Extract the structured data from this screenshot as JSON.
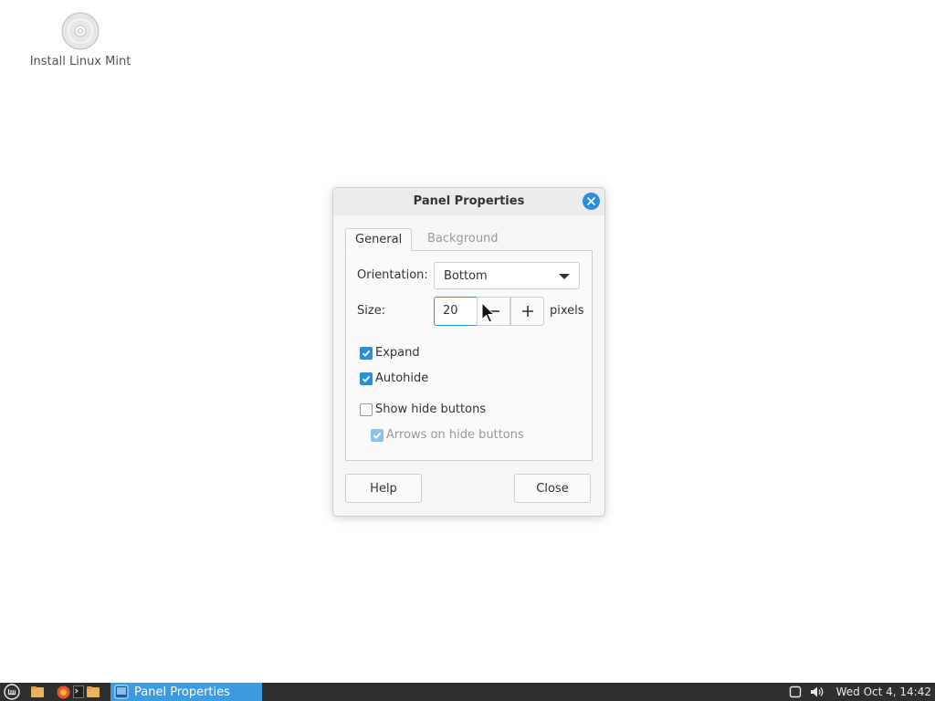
{
  "desktop": {
    "icons": [
      {
        "label": "Install Linux Mint",
        "icon": "disc-icon"
      }
    ]
  },
  "dialog": {
    "title": "Panel Properties",
    "tabs": [
      {
        "label": "General",
        "active": true
      },
      {
        "label": "Background",
        "active": false
      }
    ],
    "orientation": {
      "label": "Orientation:",
      "value": "Bottom"
    },
    "size": {
      "label": "Size:",
      "value": "20",
      "unit": "pixels"
    },
    "options": {
      "expand": {
        "label": "Expand",
        "checked": true
      },
      "autohide": {
        "label": "Autohide",
        "checked": true
      },
      "show_hide_buttons": {
        "label": "Show hide buttons",
        "checked": false
      },
      "arrows_on_hide_buttons": {
        "label": "Arrows on hide buttons",
        "checked": true,
        "disabled": true
      }
    },
    "buttons": {
      "help": "Help",
      "close": "Close"
    }
  },
  "taskbar": {
    "launchers": [
      "menu-icon",
      "files-icon",
      "firefox-icon",
      "terminal-icon",
      "folder-icon"
    ],
    "window_button": {
      "label": "Panel Properties"
    },
    "tray": [
      "notification-icon",
      "volume-icon"
    ],
    "clock": "Wed Oct  4, 14:42"
  },
  "colors": {
    "accent": "#2a8fd6",
    "taskbar": "#2f2f2f",
    "taskbar_active": "#3d9be0"
  }
}
